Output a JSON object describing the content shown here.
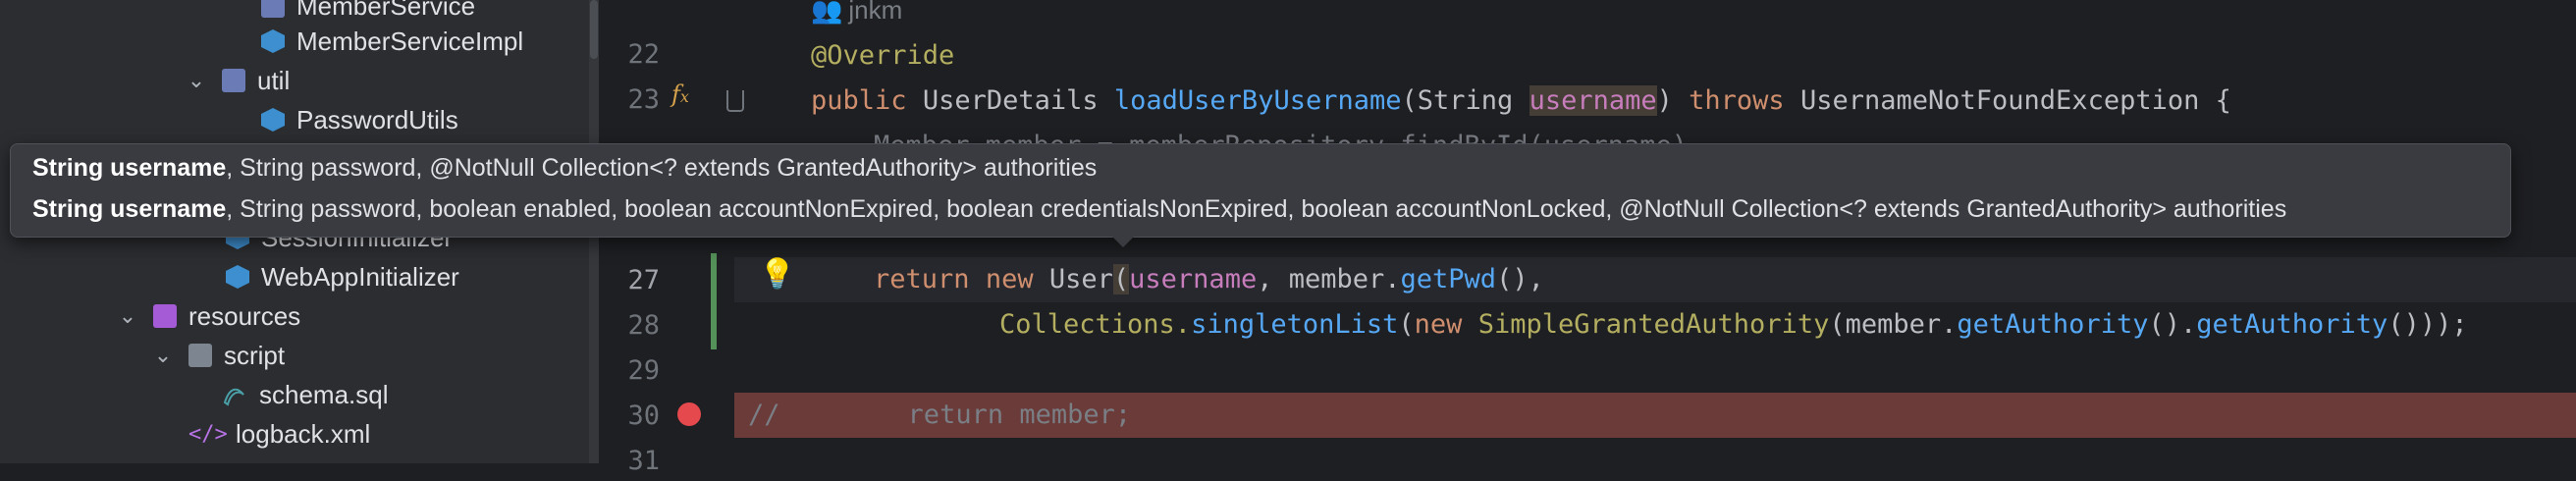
{
  "project_tree": {
    "items": [
      {
        "label": "MemberService",
        "icon": "interface-icon"
      },
      {
        "label": "MemberServiceImpl",
        "icon": "class-icon"
      },
      {
        "label": "util",
        "icon": "package-icon"
      },
      {
        "label": "PasswordUtils",
        "icon": "class-icon"
      },
      {
        "label": "SessionInitializer",
        "icon": "class-icon"
      },
      {
        "label": "WebAppInitializer",
        "icon": "class-icon"
      },
      {
        "label": "resources",
        "icon": "resources-folder-icon"
      },
      {
        "label": "script",
        "icon": "folder-icon"
      },
      {
        "label": "schema.sql",
        "icon": "sql-file-icon"
      },
      {
        "label": "logback.xml",
        "icon": "xml-file-icon"
      }
    ]
  },
  "editor": {
    "author_hint": "jnkm",
    "line_numbers": [
      "22",
      "23",
      "27",
      "28",
      "29",
      "30",
      "31"
    ],
    "lines": {
      "l22": {
        "annotation": "@Override"
      },
      "l23": {
        "kw1": "public",
        "type1": "UserDetails",
        "method": "loadUserByUsername",
        "open": "(",
        "type2": "String",
        "param": "username",
        "close": ")",
        "kw2": "throws",
        "type3": "UsernameNotFoundException",
        "brace": "{"
      },
      "l24_partial": "Member member = memberRepository.findById(username)",
      "l27": {
        "kw1": "return",
        "kw2": "new",
        "type": "User",
        "open": "(",
        "param": "username",
        "rest1": ", member.",
        "call": "getPwd",
        "rest2": "(),"
      },
      "l28": {
        "cls": "Collections.",
        "call1": "singletonList",
        "open": "(",
        "kw": "new",
        "type": "SimpleGrantedAuthority",
        "rest1": "(member.",
        "call2": "getAuthority",
        "rest2": "().",
        "call3": "getAuthority",
        "end": "()));"
      },
      "l30": {
        "comment": "//        return member;"
      }
    }
  },
  "param_info_popup": {
    "rows": [
      {
        "bold": "String username",
        "rest": ", String password, @NotNull Collection<? extends GrantedAuthority> authorities"
      },
      {
        "bold": "String username",
        "rest": ", String password, boolean enabled, boolean accountNonExpired, boolean credentialsNonExpired, boolean accountNonLocked, @NotNull Collection<? extends GrantedAuthority> authorities"
      }
    ]
  },
  "colors": {
    "keyword": "#cf8e6d",
    "method": "#56a8f5",
    "parameter": "#c77dbb",
    "annotation": "#b3ae60",
    "breakpoint": "#e5484d",
    "breakpoint_line_bg": "#6b3b39"
  }
}
